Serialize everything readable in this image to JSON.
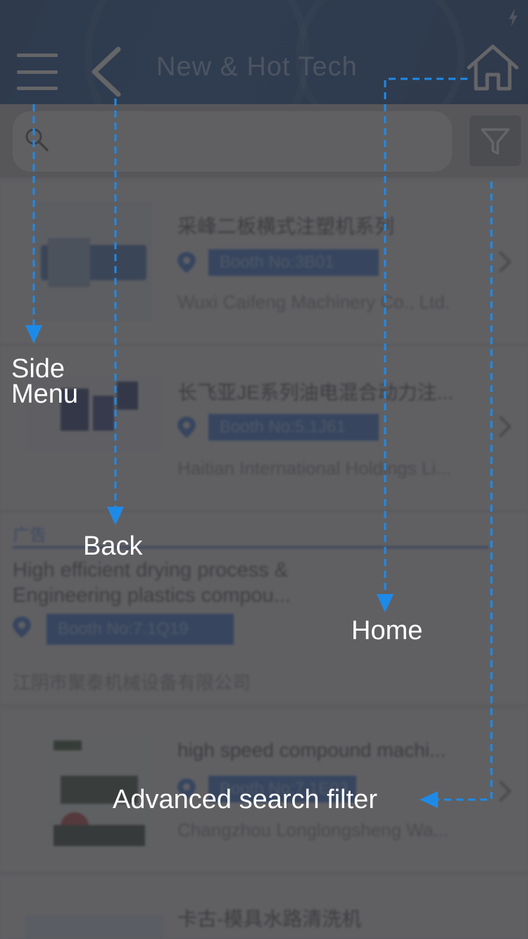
{
  "header": {
    "title": "New & Hot Tech"
  },
  "search": {
    "placeholder": ""
  },
  "items": [
    {
      "title": "采峰二板横式注塑机系列",
      "booth": "Booth No:3B01",
      "company": "Wuxi Caifeng Machinery Co., Ltd."
    },
    {
      "title": "长飞亚JE系列油电混合动力注...",
      "booth": "Booth No:5.1J61",
      "company": "Haitian International Holdings Li..."
    },
    {
      "title": "high speed compound machi...",
      "booth": "Booth No:7.1E03",
      "company": "Changzhou Longlongsheng Wa..."
    },
    {
      "title": "卡古-模具水路清洗机",
      "booth": "",
      "company": ""
    }
  ],
  "ad": {
    "tag": "广告",
    "title_line1": "High efficient drying process &",
    "title_line2": "Engineering plastics compou...",
    "booth": "Booth No:7.1Q19",
    "company": "江阴市聚泰机械设备有限公司"
  },
  "callouts": {
    "side_menu_line1": "Side",
    "side_menu_line2": "Menu",
    "back": "Back",
    "home": "Home",
    "filter": "Advanced search filter"
  },
  "icons": {
    "menu": "hamburger-icon",
    "back": "chevron-left-icon",
    "home": "home-icon",
    "search": "search-icon",
    "filter": "funnel-icon",
    "location": "location-pin-icon"
  },
  "colors": {
    "header_bg": "#0e4a98",
    "booth_badge": "#2f6fd6",
    "callout_arrow": "#1e8ae8"
  }
}
